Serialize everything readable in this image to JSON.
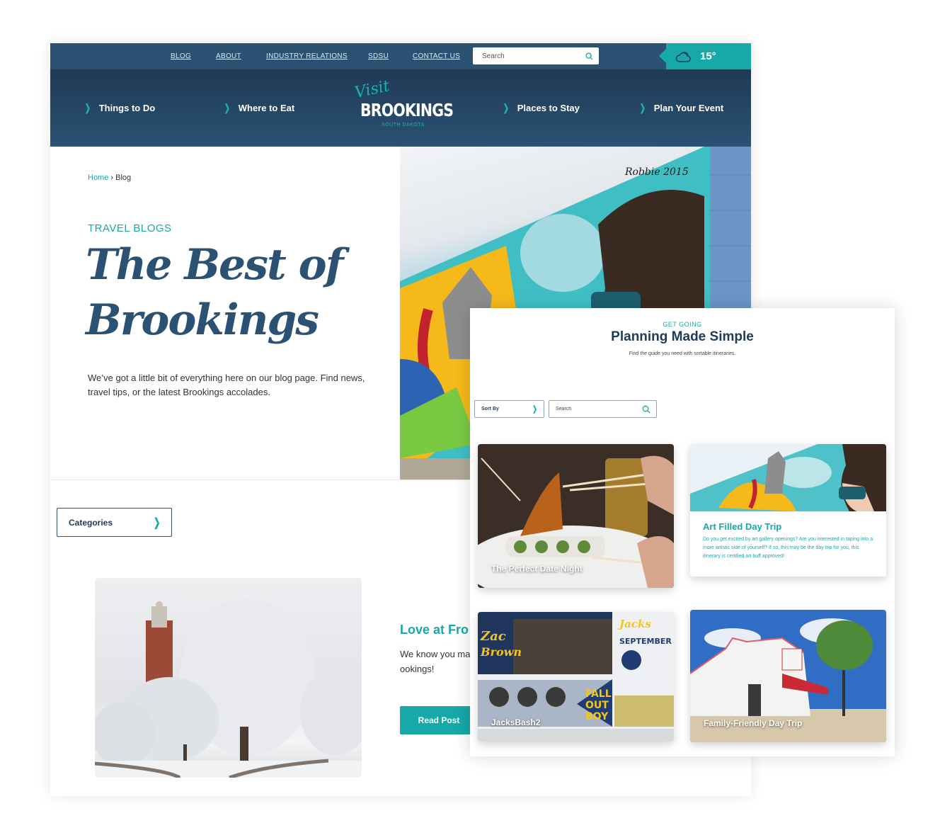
{
  "utility_nav": {
    "links": [
      "BLOG",
      "ABOUT",
      "INDUSTRY RELATIONS",
      "SDSU",
      "CONTACT US"
    ],
    "search_placeholder": "Search",
    "weather": {
      "icon": "cloud-icon",
      "temperature": "15°"
    }
  },
  "main_nav": {
    "items": [
      {
        "label": "Things to Do"
      },
      {
        "label": "Where to Eat"
      },
      {
        "label": "Places to Stay"
      },
      {
        "label": "Plan Your Event"
      }
    ],
    "logo": {
      "script": "Visit",
      "name": "BROOKINGS",
      "sub": "SOUTH DAKOTA"
    }
  },
  "breadcrumb": {
    "home": "Home",
    "separator": "›",
    "current": "Blog"
  },
  "hero": {
    "eyebrow": "TRAVEL BLOGS",
    "title": "The Best of Brookings",
    "description": "We’ve got a little bit of everything here on our blog page. Find news, travel tips, or the latest Brookings accolades.",
    "photo_alt": "Colorful mural on brick wall signed Robbie 2015"
  },
  "categories": {
    "label": "Categories"
  },
  "featured_post": {
    "title": "Love at Fro",
    "excerpt": "We know you ma snow better plac Brrr-ookings!",
    "button": "Read Post",
    "photo_alt": "Campanile tower with frost-covered trees"
  },
  "panel": {
    "eyebrow": "GET GOING",
    "title": "Planning Made Simple",
    "subtitle": "Find the guide you need with sortable itineraries.",
    "sort_label": "Sort By",
    "search_placeholder": "Search",
    "cards": [
      {
        "title": "The Perfect Date Night"
      },
      {
        "title": "Art Filled Day Trip",
        "description": "Do you get excited by art gallery openings? Are you interested in taping into a more artistic side of yourself? If so, this may be the day trip for you, this itinerary is certified art buff approved!"
      },
      {
        "title": "JacksBash2"
      },
      {
        "title": "Family-Friendly Day Trip"
      }
    ]
  },
  "colors": {
    "navy": "#2c5273",
    "teal": "#16a9a8",
    "dark_navy": "#1e3b57"
  }
}
